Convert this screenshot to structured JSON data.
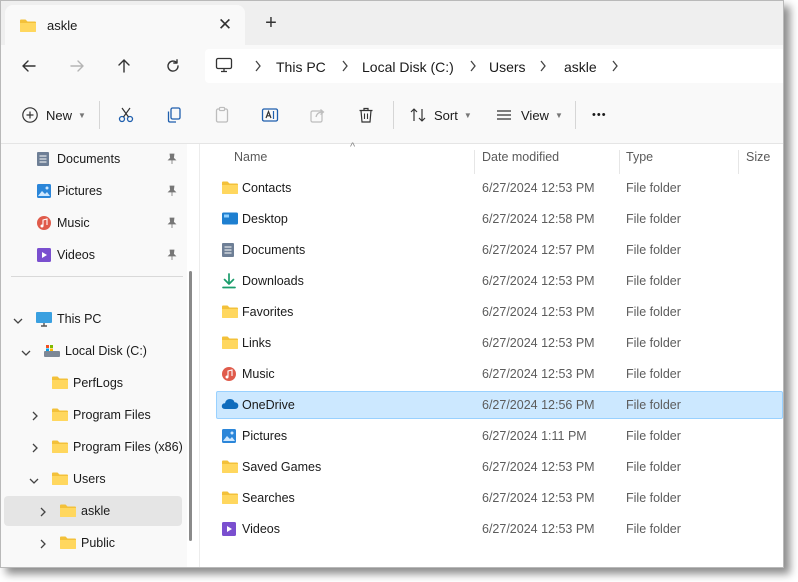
{
  "window": {
    "tab_title": "askle",
    "colors": {
      "accent": "#0067c0",
      "selection": "#cce8ff",
      "folder": "#f3c13a"
    }
  },
  "address": {
    "crumbs": [
      "This PC",
      "Local Disk (C:)",
      "Users",
      "askle"
    ]
  },
  "toolbar": {
    "new_label": "New",
    "sort_label": "Sort",
    "view_label": "View",
    "more_label": "•••"
  },
  "nav": {
    "quick_access": [
      {
        "label": "Documents",
        "icon": "documents-icon"
      },
      {
        "label": "Pictures",
        "icon": "pictures-icon"
      },
      {
        "label": "Music",
        "icon": "music-icon"
      },
      {
        "label": "Videos",
        "icon": "videos-icon"
      }
    ],
    "tree": [
      {
        "label": "This PC",
        "icon": "computer-icon"
      },
      {
        "label": "Local Disk (C:)",
        "icon": "drive-icon"
      },
      {
        "label": "PerfLogs",
        "icon": "folder-icon"
      },
      {
        "label": "Program Files",
        "icon": "folder-icon"
      },
      {
        "label": "Program Files (x86)",
        "icon": "folder-icon"
      },
      {
        "label": "Users",
        "icon": "folder-icon"
      },
      {
        "label": "askle",
        "icon": "folder-icon"
      },
      {
        "label": "Public",
        "icon": "folder-icon"
      }
    ]
  },
  "list": {
    "columns": [
      "Name",
      "Date modified",
      "Type",
      "Size"
    ],
    "rows": [
      {
        "name": "Contacts",
        "date": "6/27/2024 12:53 PM",
        "type": "File folder",
        "icon": "folder-icon"
      },
      {
        "name": "Desktop",
        "date": "6/27/2024 12:58 PM",
        "type": "File folder",
        "icon": "desktop-icon"
      },
      {
        "name": "Documents",
        "date": "6/27/2024 12:57 PM",
        "type": "File folder",
        "icon": "documents-icon"
      },
      {
        "name": "Downloads",
        "date": "6/27/2024 12:53 PM",
        "type": "File folder",
        "icon": "downloads-icon"
      },
      {
        "name": "Favorites",
        "date": "6/27/2024 12:53 PM",
        "type": "File folder",
        "icon": "folder-icon"
      },
      {
        "name": "Links",
        "date": "6/27/2024 12:53 PM",
        "type": "File folder",
        "icon": "folder-icon"
      },
      {
        "name": "Music",
        "date": "6/27/2024 12:53 PM",
        "type": "File folder",
        "icon": "music-icon"
      },
      {
        "name": "OneDrive",
        "date": "6/27/2024 12:56 PM",
        "type": "File folder",
        "icon": "onedrive-icon"
      },
      {
        "name": "Pictures",
        "date": "6/27/2024 1:11 PM",
        "type": "File folder",
        "icon": "pictures-icon"
      },
      {
        "name": "Saved Games",
        "date": "6/27/2024 12:53 PM",
        "type": "File folder",
        "icon": "folder-icon"
      },
      {
        "name": "Searches",
        "date": "6/27/2024 12:53 PM",
        "type": "File folder",
        "icon": "folder-icon"
      },
      {
        "name": "Videos",
        "date": "6/27/2024 12:53 PM",
        "type": "File folder",
        "icon": "videos-icon"
      }
    ]
  }
}
